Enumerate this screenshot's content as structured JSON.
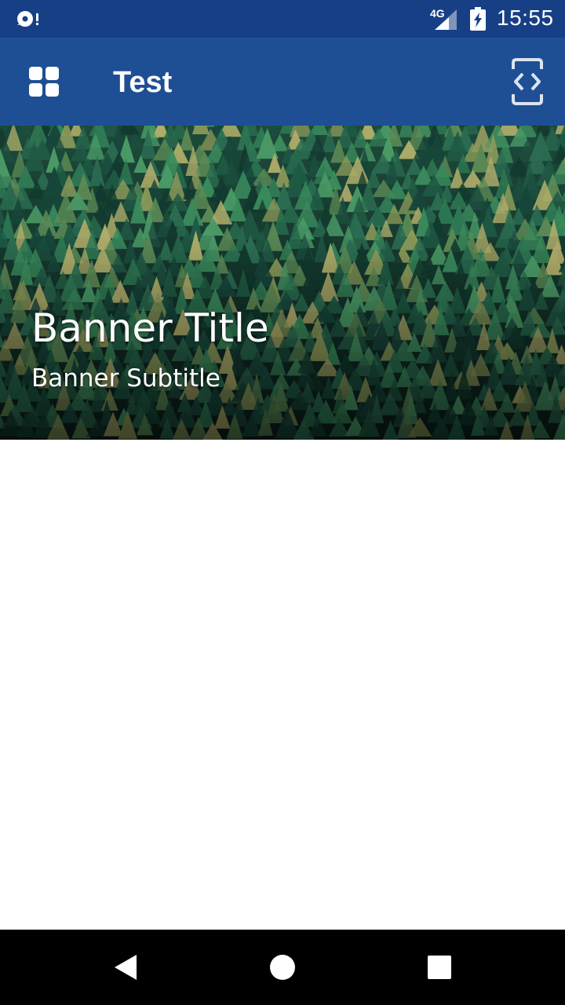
{
  "status_bar": {
    "network_type": "4G",
    "time": "15:55",
    "icons": [
      "sync-alert-icon",
      "signal-icon",
      "battery-charging-icon"
    ]
  },
  "app_bar": {
    "title": "Test",
    "menu_icon": "apps-grid-icon",
    "action_icon": "code-device-icon",
    "color": "#1e4f95",
    "status_color": "#163f86"
  },
  "banner": {
    "title": "Banner Title",
    "subtitle": "Banner Subtitle",
    "image": "pine-forest-aerial"
  },
  "nav_bar": {
    "buttons": [
      "back-icon",
      "home-icon",
      "recents-icon"
    ]
  }
}
